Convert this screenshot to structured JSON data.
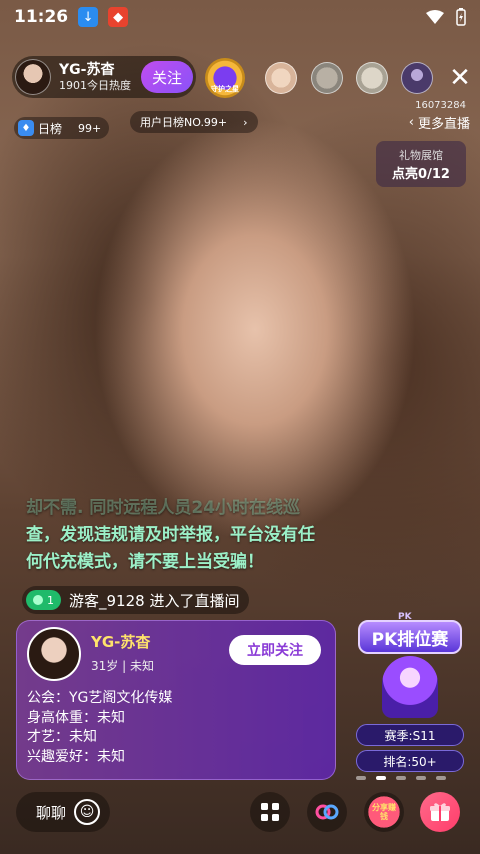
{
  "status_bar": {
    "time": "11:26",
    "icons": [
      "download-icon",
      "app-notification-icon",
      "wifi-icon",
      "battery-icon"
    ]
  },
  "host": {
    "name": "YG-苏杳",
    "heat": "1901今日热度",
    "follow_label": "关注"
  },
  "badge_label": "守护之星",
  "room_id": "16073284",
  "daily_rank": {
    "label": "日榜",
    "count": "99+"
  },
  "user_rank": {
    "label": "用户日榜NO.99+"
  },
  "more_live": {
    "label": "更多直播"
  },
  "gift_hall": {
    "title": "礼物展馆",
    "progress": "点亮0/12"
  },
  "notice": {
    "faded_line": "却不需. 同时远程人员24小时在线巡",
    "lines": [
      "查，发现违规请及时举报，平台没有任",
      "何代充模式，请不要上当受骗！"
    ]
  },
  "enter_message": {
    "level": "1",
    "text": "游客_9128 进入了直播间"
  },
  "host_card": {
    "name": "YG-苏杳",
    "meta": "31岁 | 未知",
    "follow_label": "立即关注",
    "lines": [
      "公会：YG艺阁文化传媒",
      "身高体重：未知",
      "才艺：未知",
      "兴趣爱好：未知"
    ]
  },
  "pk": {
    "banner_small": "PK",
    "banner": "PK排位赛",
    "season": "赛季:S11",
    "rank": "排名:50+"
  },
  "bottom_bar": {
    "chat_label": "聊聊",
    "share_label": "分享赚钱"
  },
  "colors": {
    "accent": "#8a52f7",
    "notice_text": "#9cf0c8",
    "card_name": "#ffe36b",
    "level_badge": "#1fba6a"
  }
}
